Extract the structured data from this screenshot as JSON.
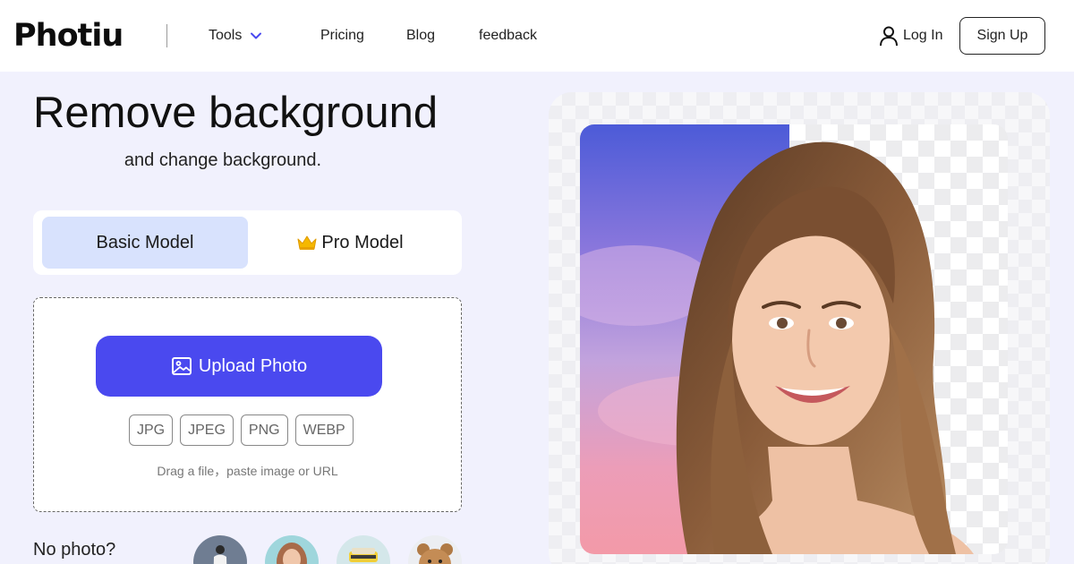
{
  "header": {
    "logo": "Photiu",
    "nav": {
      "tools": "Tools",
      "pricing": "Pricing",
      "blog": "Blog",
      "feedback": "feedback"
    },
    "login": "Log In",
    "signup": "Sign Up"
  },
  "hero": {
    "title": "Remove background",
    "subtitle": "and change background."
  },
  "model_tabs": {
    "basic": "Basic Model",
    "pro": "Pro Model",
    "selected": "Basic Model"
  },
  "upload": {
    "button": "Upload Photo",
    "formats": [
      "JPG",
      "JPEG",
      "PNG",
      "WEBP"
    ],
    "hint": "Drag a file，paste image or URL"
  },
  "samples": {
    "label": "No photo?"
  },
  "colors": {
    "accent": "#4a49ef",
    "selected_tab": "#d8e2fd",
    "page_bg": "#f1f1fd"
  },
  "icons": [
    "chevron-down-icon",
    "user-icon",
    "crown-icon",
    "image-icon"
  ]
}
